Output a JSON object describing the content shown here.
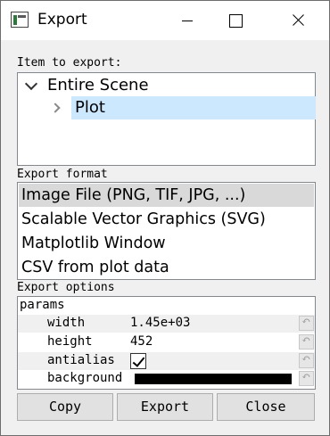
{
  "window": {
    "title": "Export",
    "icon": "pyqtgraph-app-icon"
  },
  "item_section": {
    "label": "Item to export:",
    "tree": [
      {
        "label": "Entire Scene",
        "expanded": true
      },
      {
        "label": "Plot",
        "selected": true
      }
    ]
  },
  "format_section": {
    "label": "Export format",
    "items": [
      "Image File (PNG, TIF, JPG, ...)",
      "Scalable Vector Graphics (SVG)",
      "Matplotlib Window",
      "CSV from plot data"
    ],
    "selected_index": 0
  },
  "options_section": {
    "label": "Export options",
    "group": "params",
    "params": {
      "width": {
        "name": "width",
        "value": "1.45e+03"
      },
      "height": {
        "name": "height",
        "value": "452"
      },
      "antialias": {
        "name": "antialias",
        "checked": true
      },
      "background": {
        "name": "background",
        "color": "#000000"
      }
    }
  },
  "buttons": {
    "copy": "Copy",
    "export": "Export",
    "close": "Close"
  },
  "colors": {
    "selection": "#cce8ff",
    "list_selected": "#d9d9d9"
  }
}
